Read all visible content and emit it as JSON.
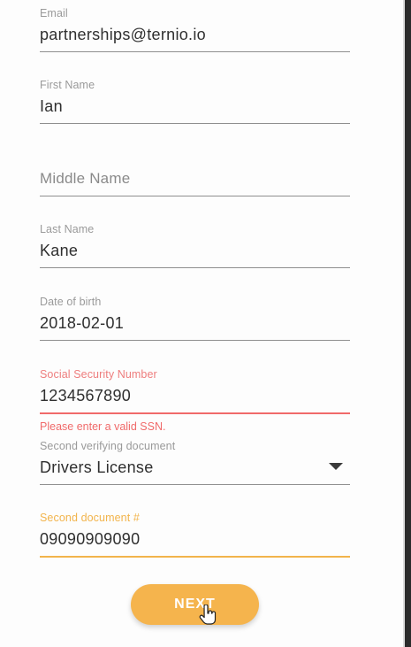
{
  "form": {
    "email": {
      "label": "Email",
      "value": "partnerships@ternio.io"
    },
    "first_name": {
      "label": "First Name",
      "value": "Ian"
    },
    "middle_name": {
      "placeholder": "Middle Name"
    },
    "last_name": {
      "label": "Last Name",
      "value": "Kane"
    },
    "dob": {
      "label": "Date of birth",
      "value": "2018-02-01"
    },
    "ssn": {
      "label": "Social Security Number",
      "value": "1234567890",
      "error": "Please enter a valid SSN."
    },
    "second_doc": {
      "label": "Second verifying document",
      "value": "Drivers License"
    },
    "second_doc_number": {
      "label": "Second document #",
      "value": "09090909090"
    }
  },
  "actions": {
    "next_label": "NEXT"
  },
  "colors": {
    "accent": "#f5b44d",
    "error": "#f06a6a"
  }
}
